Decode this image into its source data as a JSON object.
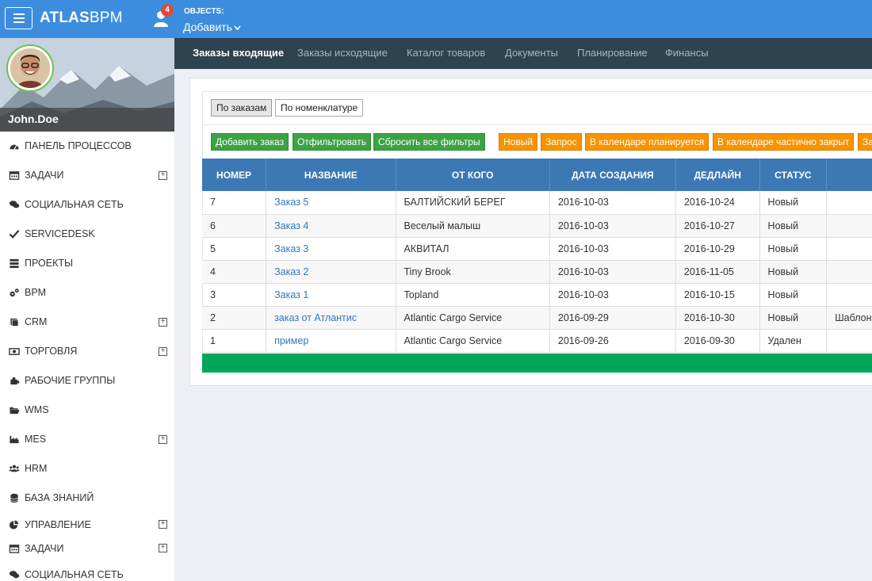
{
  "header": {
    "logo_bold": "ATLAS",
    "logo_light": "BPM",
    "badge": "4",
    "objects_label": "OBJECTS:",
    "objects_add": "Добавить"
  },
  "user": {
    "name": "John.Doe"
  },
  "sidebar": {
    "items": [
      {
        "label": "ПАНЕЛЬ ПРОЦЕССОВ",
        "icon": "dashboard-icon",
        "expandable": false
      },
      {
        "label": "ЗАДАЧИ",
        "icon": "calendar-icon",
        "expandable": true
      },
      {
        "label": "СОЦИАЛЬНАЯ СЕТЬ",
        "icon": "comments-icon",
        "expandable": false
      },
      {
        "label": "SERVICEDESK",
        "icon": "check-icon",
        "expandable": false
      },
      {
        "label": "ПРОЕКТЫ",
        "icon": "list-icon",
        "expandable": false
      },
      {
        "label": "BPM",
        "icon": "gears-icon",
        "expandable": false
      },
      {
        "label": "CRM",
        "icon": "book-icon",
        "expandable": true
      },
      {
        "label": "ТОРГОВЛЯ",
        "icon": "money-icon",
        "expandable": true
      },
      {
        "label": "РАБОЧИЕ ГРУППЫ",
        "icon": "puzzle-icon",
        "expandable": false
      },
      {
        "label": "WMS",
        "icon": "folder-open-icon",
        "expandable": false
      },
      {
        "label": "MES",
        "icon": "industry-icon",
        "expandable": true
      },
      {
        "label": "HRM",
        "icon": "users-icon",
        "expandable": false
      },
      {
        "label": "БАЗА ЗНАНИЙ",
        "icon": "database-icon",
        "expandable": false
      },
      {
        "label": "УПРАВЛЕНИЕ",
        "icon": "pie-chart-icon",
        "expandable": true
      },
      {
        "label": "ЗАДАЧИ",
        "icon": "calendar-icon",
        "expandable": true
      },
      {
        "label": "СОЦИАЛЬНАЯ СЕТЬ",
        "icon": "comments-icon",
        "expandable": false
      }
    ],
    "expand_glyph": "+"
  },
  "nav": {
    "tabs": [
      "Заказы входящие",
      "Заказы исходящие",
      "Каталог товаров",
      "Документы",
      "Планирование",
      "Финансы"
    ]
  },
  "view_toggle": [
    "По заказам",
    "По номенклатуре"
  ],
  "actions": [
    "Добавить заказ",
    "Отфильтровать",
    "Сбросить все фильтры"
  ],
  "status_filters": [
    "Новый",
    "Запрос",
    "В календаре планируется",
    "В календаре частично закрыт",
    "За"
  ],
  "table": {
    "columns": [
      "НОМЕР",
      "НАЗВАНИЕ",
      "ОТ КОГО",
      "ДАТА СОЗДАНИЯ",
      "ДЕДЛАЙН",
      "СТАТУС",
      ""
    ],
    "rows": [
      {
        "num": "7",
        "name": "Заказ 5",
        "from": "БАЛТИЙСКИЙ БЕРЕГ",
        "created": "2016-10-03",
        "deadline": "2016-10-24",
        "status": "Новый",
        "extra": ""
      },
      {
        "num": "6",
        "name": "Заказ 4",
        "from": "Веселый малыш",
        "created": "2016-10-03",
        "deadline": "2016-10-27",
        "status": "Новый",
        "extra": ""
      },
      {
        "num": "5",
        "name": "Заказ 3",
        "from": "АКВИТАЛ",
        "created": "2016-10-03",
        "deadline": "2016-10-29",
        "status": "Новый",
        "extra": ""
      },
      {
        "num": "4",
        "name": "Заказ 2",
        "from": "Tiny Brook",
        "created": "2016-10-03",
        "deadline": "2016-11-05",
        "status": "Новый",
        "extra": ""
      },
      {
        "num": "3",
        "name": "Заказ 1",
        "from": "Topland",
        "created": "2016-10-03",
        "deadline": "2016-10-15",
        "status": "Новый",
        "extra": ""
      },
      {
        "num": "2",
        "name": "заказ от Атлантис",
        "from": "Atlantic Cargo Service",
        "created": "2016-09-29",
        "deadline": "2016-10-30",
        "status": "Новый",
        "extra": "Шаблон"
      },
      {
        "num": "1",
        "name": "пример",
        "from": "Atlantic Cargo Service",
        "created": "2016-09-26",
        "deadline": "2016-09-30",
        "status": "Удален",
        "extra": ""
      }
    ]
  },
  "colors": {
    "topbar": "#3c8dde",
    "navbar": "#2f4250",
    "table_header": "#3c78b4",
    "green": "#3ca345",
    "orange": "#f79400",
    "link": "#3277b8",
    "total_bar": "#00a65a"
  }
}
